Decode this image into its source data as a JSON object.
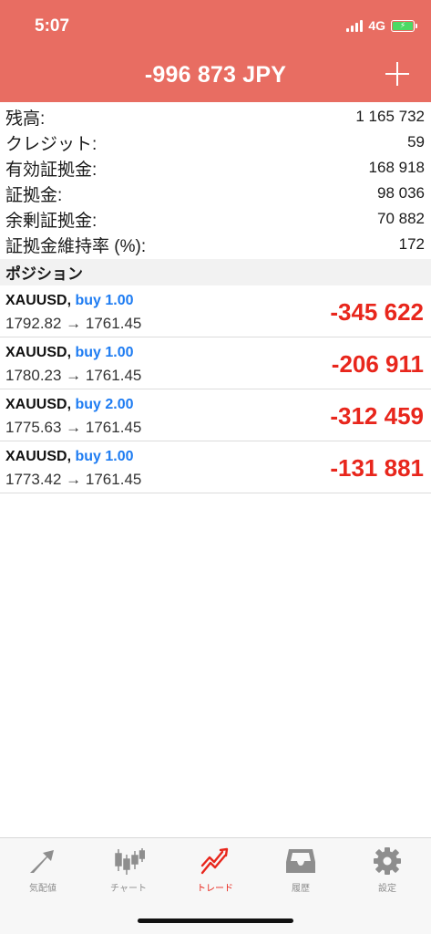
{
  "status_bar": {
    "time": "5:07",
    "network": "4G"
  },
  "header": {
    "title": "-996 873 JPY"
  },
  "summary": [
    {
      "label": "残高:",
      "value": "1 165 732"
    },
    {
      "label": "クレジット:",
      "value": "59"
    },
    {
      "label": "有効証拠金:",
      "value": "168 918"
    },
    {
      "label": "証拠金:",
      "value": "98 036"
    },
    {
      "label": "余剰証拠金:",
      "value": "70 882"
    },
    {
      "label": "証拠金維持率 (%):",
      "value": "172"
    }
  ],
  "positions_section": {
    "title": "ポジション"
  },
  "positions": [
    {
      "symbol": "XAUUSD,",
      "type": "buy 1.00",
      "prices": "1792.82 → 1761.45",
      "profit": "-345 622"
    },
    {
      "symbol": "XAUUSD,",
      "type": "buy 1.00",
      "prices": "1780.23 → 1761.45",
      "profit": "-206 911"
    },
    {
      "symbol": "XAUUSD,",
      "type": "buy 2.00",
      "prices": "1775.63 → 1761.45",
      "profit": "-312 459"
    },
    {
      "symbol": "XAUUSD,",
      "type": "buy 1.00",
      "prices": "1773.42 → 1761.45",
      "profit": "-131 881"
    }
  ],
  "tabs": [
    {
      "label": "気配値",
      "icon": "quotes-arrows-icon",
      "active": false
    },
    {
      "label": "チャート",
      "icon": "candlestick-chart-icon",
      "active": false
    },
    {
      "label": "トレード",
      "icon": "trade-chart-icon",
      "active": true
    },
    {
      "label": "履歴",
      "icon": "inbox-tray-icon",
      "active": false
    },
    {
      "label": "設定",
      "icon": "gear-icon",
      "active": false
    }
  ],
  "colors": {
    "header_bg": "#e86d62",
    "buy_blue": "#1e7cf2",
    "loss_red": "#e8261c",
    "tab_inactive": "#8e8e8e",
    "battery_green": "#4cd964"
  }
}
